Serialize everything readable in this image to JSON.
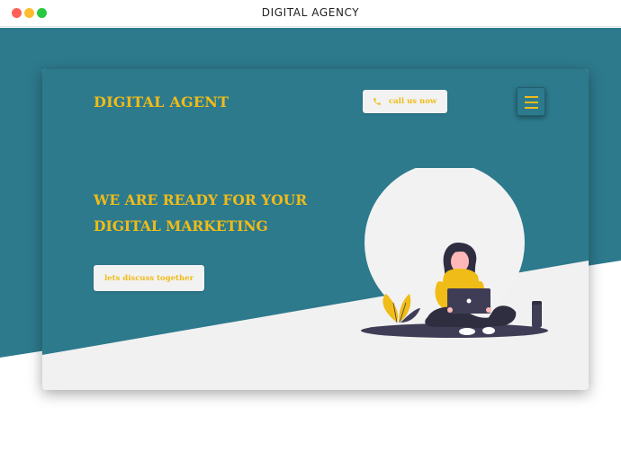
{
  "window": {
    "title": "DIGITAL AGENCY",
    "controls": [
      "close",
      "minimize",
      "maximize"
    ]
  },
  "header": {
    "brand": "DIGITAL AGENT",
    "call_button": {
      "icon": "phone-icon",
      "label": "call us now"
    },
    "menu_button": {
      "icon": "hamburger-menu-icon"
    }
  },
  "hero": {
    "headline_line1": "WE ARE READY FOR YOUR",
    "headline_line2": "DIGITAL MARKETING",
    "cta_label": "lets discuss together"
  },
  "illustration": {
    "name": "woman-with-laptop-illustration"
  },
  "colors": {
    "teal": "#2d7a8d",
    "accent_yellow": "#f0bc17",
    "light_gray": "#f1f1f1",
    "dark": "#3f3d56"
  }
}
